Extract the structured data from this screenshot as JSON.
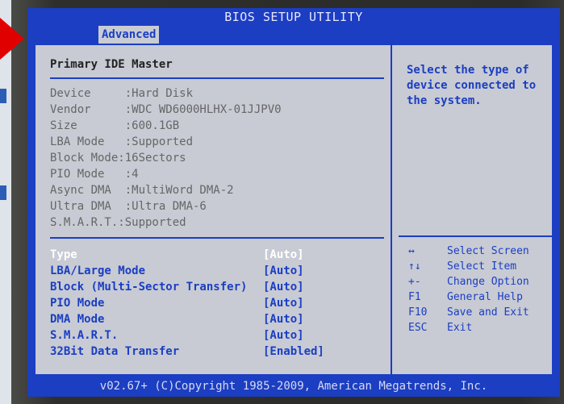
{
  "title": "BIOS SETUP UTILITY",
  "tab": "Advanced",
  "heading": "Primary IDE Master",
  "info": [
    "Device     :Hard Disk",
    "Vendor     :WDC WD6000HLHX-01JJPV0",
    "Size       :600.1GB",
    "LBA Mode   :Supported",
    "Block Mode:16Sectors",
    "PIO Mode   :4",
    "Async DMA  :MultiWord DMA-2",
    "Ultra DMA  :Ultra DMA-6",
    "S.M.A.R.T.:Supported"
  ],
  "options": [
    {
      "label": "Type",
      "value": "[Auto]"
    },
    {
      "label": "LBA/Large Mode",
      "value": "[Auto]"
    },
    {
      "label": "Block (Multi-Sector Transfer)",
      "value": "[Auto]"
    },
    {
      "label": "PIO Mode",
      "value": "[Auto]"
    },
    {
      "label": "DMA Mode",
      "value": "[Auto]"
    },
    {
      "label": "S.M.A.R.T.",
      "value": "[Auto]"
    },
    {
      "label": "32Bit Data Transfer",
      "value": "[Enabled]"
    }
  ],
  "help": "Select the type of device connected to the system.",
  "keys": [
    {
      "key": "↔",
      "desc": "Select Screen"
    },
    {
      "key": "↑↓",
      "desc": "Select Item"
    },
    {
      "key": "+-",
      "desc": "Change Option"
    },
    {
      "key": "F1",
      "desc": "General Help"
    },
    {
      "key": "F10",
      "desc": "Save and Exit"
    },
    {
      "key": "ESC",
      "desc": "Exit"
    }
  ],
  "footer": "v02.67+ (C)Copyright 1985-2009, American Megatrends, Inc.",
  "colors": {
    "bios_blue": "#1b3ec2",
    "panel_gray": "#c8cbd4",
    "arrow_red": "#e00000"
  },
  "icons": {
    "arrow": "red-arrow-icon"
  }
}
